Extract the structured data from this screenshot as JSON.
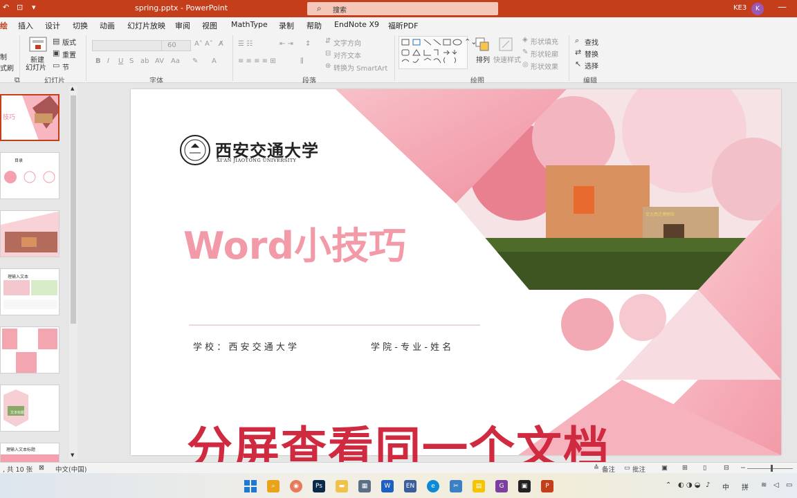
{
  "window": {
    "doc_title": "spring.pptx - PowerPoint",
    "user": "KE3",
    "avatar_letter": "K"
  },
  "search": {
    "placeholder": "搜索"
  },
  "menu": {
    "tabs": [
      "绘",
      "插入",
      "设计",
      "切换",
      "动画",
      "幻灯片放映",
      "审阅",
      "视图",
      "MathType",
      "录制",
      "帮助",
      "EndNote X9",
      "福昕PDF"
    ]
  },
  "ribbon": {
    "slides_group": {
      "new_slide": "新建",
      "new_slide2": "幻灯片",
      "layout": "版式",
      "reset": "重置",
      "section": "节",
      "label": "幻灯片"
    },
    "font_group": {
      "font_size": "60",
      "label": "字体"
    },
    "paragraph_group": {
      "text_direction": "文字方向",
      "align_text": "对齐文本",
      "smartart": "转换为 SmartArt",
      "label": "段落"
    },
    "drawing_group": {
      "arrange": "排列",
      "quick_styles": "快速样式",
      "shape_fill": "形状填充",
      "shape_outline": "形状轮廓",
      "shape_effect": "形状效果",
      "label": "绘图"
    },
    "editing_group": {
      "find": "查找",
      "replace": "替换",
      "select": "选择",
      "label": "编辑"
    },
    "left_cut": {
      "a": "制",
      "b": "式刷"
    }
  },
  "slide": {
    "university_cn": "西安交通大学",
    "university_en": "XI'AN JIAOTONG UNIVERSITY",
    "title": "Word小技巧",
    "school_line": "学 校 ：  西 安 交 通 大 学",
    "major_line": "学 院 - 专 业 - 姓 名",
    "building_sign": "交大西迁博物馆"
  },
  "thumbnails": {
    "t1_title": "技巧",
    "t2_title": "目录",
    "t4_title": "理输入文本",
    "t6_title": "文本标题",
    "t7_title": "理输入文本标题"
  },
  "statusbar": {
    "slide_count": ", 共 10 张",
    "language": "中文(中国)",
    "notes": "备注",
    "comments": "批注"
  },
  "caption": "分屏查看同一个文档",
  "colors": {
    "accent": "#c43e1c",
    "pink": "#f4a0ad",
    "title_pink": "#f29aa8",
    "caption_red": "#cf2a3f"
  }
}
